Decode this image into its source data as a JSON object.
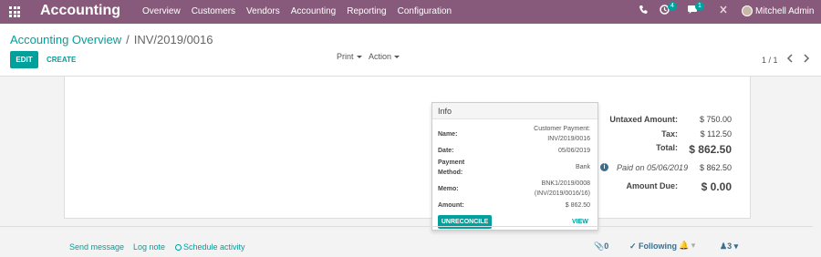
{
  "navbar": {
    "brand": "Accounting",
    "menu": [
      "Overview",
      "Customers",
      "Vendors",
      "Accounting",
      "Reporting",
      "Configuration"
    ],
    "activity_count": "4",
    "message_count": "1",
    "user_name": "Mitchell Admin",
    "color": "#875a7b"
  },
  "breadcrumb": {
    "parent": "Accounting Overview",
    "separator": "/",
    "current": "INV/2019/0016"
  },
  "buttons": {
    "edit": "EDIT",
    "create": "CREATE",
    "print": "Print",
    "action": "Action"
  },
  "pager": {
    "value": "1 / 1"
  },
  "totals": {
    "untaxed_label": "Untaxed Amount:",
    "untaxed_value": "$ 750.00",
    "tax_label": "Tax:",
    "tax_value": "$ 112.50",
    "total_label": "Total:",
    "total_value": "$ 862.50",
    "paid_label": "Paid on 05/06/2019",
    "paid_value": "$ 862.50",
    "due_label": "Amount Due:",
    "due_value": "$ 0.00"
  },
  "popover": {
    "title": "Info",
    "name_label": "Name:",
    "name_value": "Customer Payment: INV/2019/0016",
    "date_label": "Date:",
    "date_value": "05/06/2019",
    "method_label": "Payment Method:",
    "method_value": "Bank",
    "memo_label": "Memo:",
    "memo_value": "BNK1/2019/0008 (INV/2019/0016/16)",
    "amount_label": "Amount:",
    "amount_value": "$ 862.50",
    "unreconcile": "UNRECONCILE",
    "view": "VIEW"
  },
  "chatter": {
    "send_message": "Send message",
    "log_note": "Log note",
    "schedule_activity": "Schedule activity",
    "attachments": "0",
    "following": "Following",
    "followers": "3"
  },
  "colors": {
    "accent": "#00a09d",
    "brand": "#875a7b"
  }
}
